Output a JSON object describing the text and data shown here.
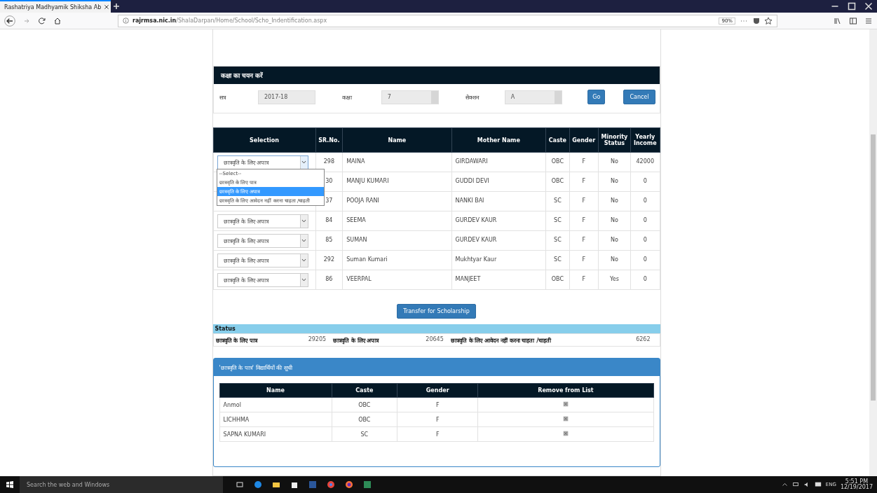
{
  "browser": {
    "tab_title": "Rashatriya Madhyamik Shiksha Ab",
    "url_host": "rajrmsa.nic.in",
    "url_path": "/ShalaDarpan/Home/School/Scho_Indentification.aspx",
    "zoom": "90%"
  },
  "filter_panel": {
    "title": "कक्षा का चयन करें",
    "fields": [
      {
        "label": "सत्र",
        "value": "2017-18",
        "kind": "text"
      },
      {
        "label": "कक्षा",
        "value": "7",
        "kind": "select"
      },
      {
        "label": "सेक्शन",
        "value": "A",
        "kind": "select"
      }
    ],
    "buttons": [
      "Go",
      "Cancel"
    ]
  },
  "students": {
    "columns": [
      "Selection",
      "SR.No.",
      "Name",
      "Mother Name",
      "Caste",
      "Gender",
      "Minority Status",
      "Yearly Income"
    ],
    "rows": [
      {
        "selection": "छात्रवृति के लिए अपात्र",
        "sr_no": "298",
        "name": "MAINA",
        "mother_name": "GIRDAWARI",
        "caste": "OBC",
        "gender": "F",
        "minority": "No",
        "income": "42000"
      },
      {
        "sr_no": "30",
        "name": "MANJU KUMARI",
        "mother_name": "GUDDI DEVI",
        "caste": "OBC",
        "gender": "F",
        "minority": "No",
        "income": "0"
      },
      {
        "sr_no": "37",
        "name": "POOJA RANI",
        "mother_name": "NANKI BAI",
        "caste": "SC",
        "gender": "F",
        "minority": "No",
        "income": "0"
      },
      {
        "selection": "छात्रवृति के लिए अपात्र",
        "sr_no": "84",
        "name": "SEEMA",
        "mother_name": "GURDEV KAUR",
        "caste": "SC",
        "gender": "F",
        "minority": "No",
        "income": "0"
      },
      {
        "selection": "छात्रवृति के लिए अपात्र",
        "sr_no": "85",
        "name": "SUMAN",
        "mother_name": "GURDEV KAUR",
        "caste": "SC",
        "gender": "F",
        "minority": "No",
        "income": "0"
      },
      {
        "selection": "छात्रवृति के लिए अपात्र",
        "sr_no": "292",
        "name": "Suman Kumari",
        "mother_name": "Mukhtyar Kaur",
        "caste": "SC",
        "gender": "F",
        "minority": "No",
        "income": "0"
      },
      {
        "selection": "छात्रवृति के लिए अपात्र",
        "sr_no": "86",
        "name": "VEERPAL",
        "mother_name": "MANJEET",
        "caste": "OBC",
        "gender": "F",
        "minority": "Yes",
        "income": "0"
      }
    ],
    "open_dropdown": {
      "options": [
        {
          "label": "--Select--",
          "selected": false
        },
        {
          "label": "छात्रवृति के लिए पात्र",
          "selected": false
        },
        {
          "label": "छात्रवृति के लिए अपात्र",
          "selected": true
        },
        {
          "label": "छात्रवृति के लिए आवेदन नहीं करना चाहता /चाहती",
          "selected": false
        }
      ]
    },
    "transfer_button": "Transfer for Scholarship"
  },
  "status": {
    "title": "Status",
    "items": [
      {
        "label": "छात्रवृति के लिए पात्र",
        "count": "29205"
      },
      {
        "label": "छात्रवृति के लिए अपात्र",
        "count": "20645"
      },
      {
        "label": "छात्रवृति के लिए आवेदन नहीं करना चाहता /चाहती",
        "count": "6262"
      }
    ]
  },
  "eligible_list": {
    "title": "'छात्रवृति के पात्र' विद्यार्थियों की सूची",
    "columns": [
      "Name",
      "Caste",
      "Gender",
      "Remove from List"
    ],
    "rows": [
      {
        "name": "Anmol",
        "caste": "OBC",
        "gender": "F"
      },
      {
        "name": "LICHHMA",
        "caste": "OBC",
        "gender": "F"
      },
      {
        "name": "SAPNA KUMARI",
        "caste": "SC",
        "gender": "F"
      }
    ]
  },
  "taskbar": {
    "search_placeholder": "Search the web and Windows",
    "language": "ENG",
    "time": "5:51 PM",
    "date": "12/19/2017"
  }
}
